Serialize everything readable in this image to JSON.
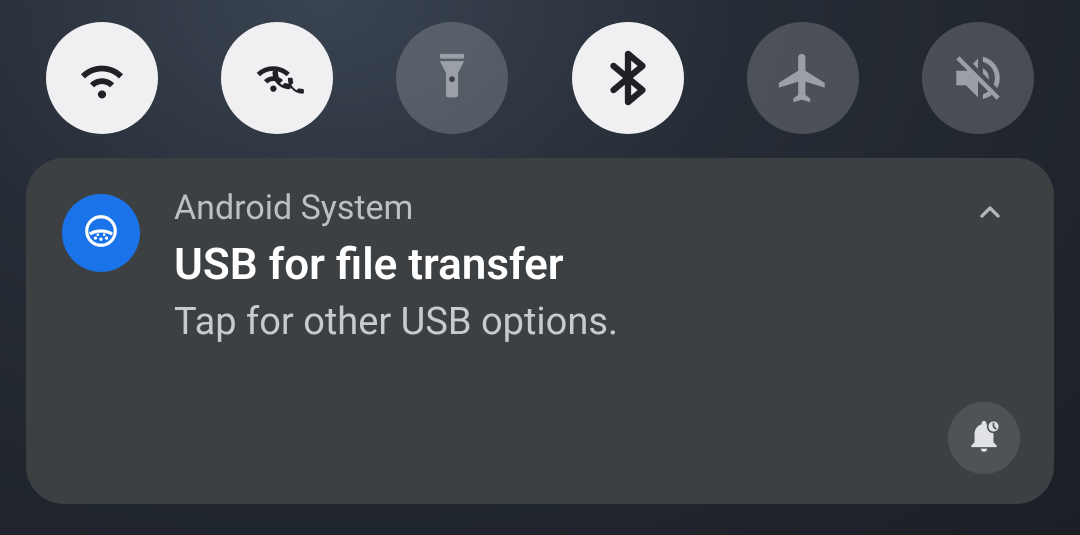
{
  "quick_settings": [
    {
      "name": "wifi",
      "active": true
    },
    {
      "name": "wifi-calling",
      "active": true
    },
    {
      "name": "flashlight",
      "active": false
    },
    {
      "name": "bluetooth",
      "active": true
    },
    {
      "name": "airplane-mode",
      "active": false
    },
    {
      "name": "mute",
      "active": false
    }
  ],
  "notification": {
    "app": "Android System",
    "title": "USB for file transfer",
    "body": "Tap for other USB options."
  },
  "colors": {
    "accent": "#1a73e8",
    "card": "#3c4043",
    "tile_on": "#f0f0f2",
    "tile_off": "rgba(255,255,255,0.18)"
  }
}
